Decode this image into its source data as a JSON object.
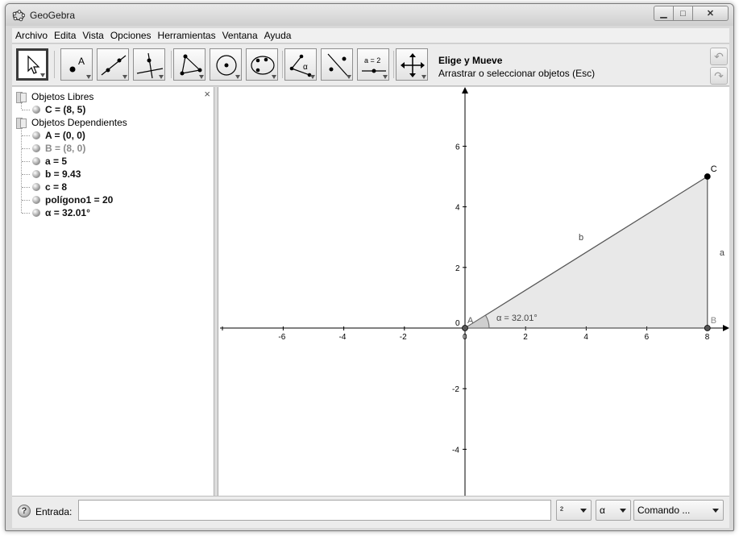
{
  "window": {
    "title": "GeoGebra",
    "min_symbol": "▁",
    "max_symbol": "□",
    "close_symbol": "✕"
  },
  "menu": [
    "Archivo",
    "Edita",
    "Vista",
    "Opciones",
    "Herramientas",
    "Ventana",
    "Ayuda"
  ],
  "toolbar": {
    "tools": [
      {
        "name": "move-tool",
        "icon": "arrow-cursor-icon"
      },
      {
        "name": "point-tool",
        "icon": "point-icon",
        "text": "A"
      },
      {
        "name": "line-tool",
        "icon": "line-through-points-icon"
      },
      {
        "name": "perpendicular-tool",
        "icon": "perpendicular-line-icon"
      },
      {
        "name": "polygon-tool",
        "icon": "polygon-icon"
      },
      {
        "name": "circle-tool",
        "icon": "circle-center-point-icon"
      },
      {
        "name": "conic-tool",
        "icon": "conic-five-points-icon"
      },
      {
        "name": "angle-tool",
        "icon": "angle-icon",
        "text": "α"
      },
      {
        "name": "reflect-tool",
        "icon": "reflect-line-icon"
      },
      {
        "name": "slider-tool",
        "icon": "slider-icon",
        "text": "a = 2"
      },
      {
        "name": "move-graphics-tool",
        "icon": "move-graphics-icon"
      }
    ],
    "help_title": "Elige y Mueve",
    "help_desc": "Arrastrar o seleccionar objetos (Esc)",
    "undo_symbol": "↶",
    "redo_symbol": "↷"
  },
  "algebra": {
    "close_symbol": "×",
    "free_header": "Objetos Libres",
    "free_items": [
      "C = (8, 5)"
    ],
    "dependent_header": "Objetos Dependientes",
    "dependent_items": [
      {
        "text": "A = (0, 0)",
        "aux": false
      },
      {
        "text": "B = (8, 0)",
        "aux": true
      },
      {
        "text": "a = 5",
        "aux": false
      },
      {
        "text": "b = 9.43",
        "aux": false
      },
      {
        "text": "c = 8",
        "aux": false
      },
      {
        "text": "polígono1 = 20",
        "aux": false
      },
      {
        "text": "α = 32.01°",
        "aux": false
      }
    ]
  },
  "graphics": {
    "x_ticks": [
      "-6",
      "-4",
      "-2",
      "0",
      "2",
      "4",
      "6",
      "8"
    ],
    "y_ticks": [
      "6",
      "4",
      "2",
      "0",
      "-2",
      "-4"
    ],
    "points": [
      {
        "label": "A",
        "x": 0,
        "y": 0
      },
      {
        "label": "B",
        "x": 8,
        "y": 0
      },
      {
        "label": "C",
        "x": 8,
        "y": 5
      }
    ],
    "segment_labels": {
      "a": "a",
      "b": "b"
    },
    "angle_label": "α = 32.01°",
    "polygon_fill": "#e8e8e8"
  },
  "inputbar": {
    "help_symbol": "?",
    "label": "Entrada:",
    "value": "",
    "sup_dropdown": "²",
    "greek_dropdown": "α",
    "command_dropdown": "Comando ..."
  }
}
